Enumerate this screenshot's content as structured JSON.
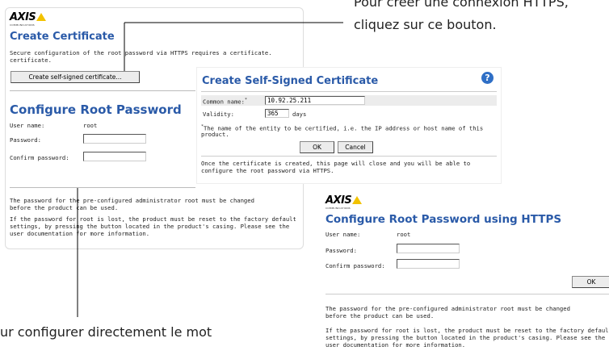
{
  "logo": {
    "text": "AXIS",
    "sub": "COMMUNICATIONS"
  },
  "left_panel": {
    "create_cert_title": "Create Certificate",
    "create_cert_desc_1": "Secure configuration of the root password via HTTPS requires a certificate.",
    "create_cert_desc_2": "certificate.",
    "create_self_signed_button": "Create self-signed certificate...",
    "configure_title": "Configure Root Password",
    "user_name_label": "User name:",
    "user_name_value": "root",
    "password_label": "Password:",
    "confirm_password_label": "Confirm password:",
    "note_1_line1": "The password for the pre-configured administrator root must be changed",
    "note_1_line2": "before the product can be used.",
    "note_2_line1": "If the password for root is lost, the product must be reset to the factory default",
    "note_2_line2": "settings, by pressing the button located in the product's casing. Please see the",
    "note_2_line3": "user documentation for more information."
  },
  "dialog": {
    "title": "Create Self-Signed Certificate",
    "help_icon_text": "?",
    "common_name_label": "Common name:",
    "common_name_value": "10.92.25.211",
    "validity_label": "Validity:",
    "validity_value": "365",
    "validity_unit": "days",
    "footnote_line1": "The name of the entity to be certified, i.e. the IP address or host name of this",
    "footnote_line2": "product.",
    "ok_button": "OK",
    "cancel_button": "Cancel",
    "info_line1": "Once the certificate is created, this page will close and you will be able to",
    "info_line2": "configure the root password via HTTPS."
  },
  "https_panel": {
    "title": "Configure Root Password using HTTPS",
    "user_name_label": "User name:",
    "user_name_value": "root",
    "password_label": "Password:",
    "confirm_password_label": "Confirm password:",
    "ok_button": "OK",
    "note_1_line1": "The password for the pre-configured administrator root must be changed",
    "note_1_line2": "before the product can be used.",
    "note_2_line1": "If the password for root is lost, the product must be reset to the factory default",
    "note_2_line2": "settings, by pressing the button located in the product's casing. Please see the",
    "note_2_line3": "user documentation for more information."
  },
  "annotations": {
    "top_right_line1": "Pour créer une connexion HTTPS,",
    "top_right_line2": "cliquez sur ce bouton.",
    "bottom_left_line1": "ur configurer directement le mot"
  }
}
